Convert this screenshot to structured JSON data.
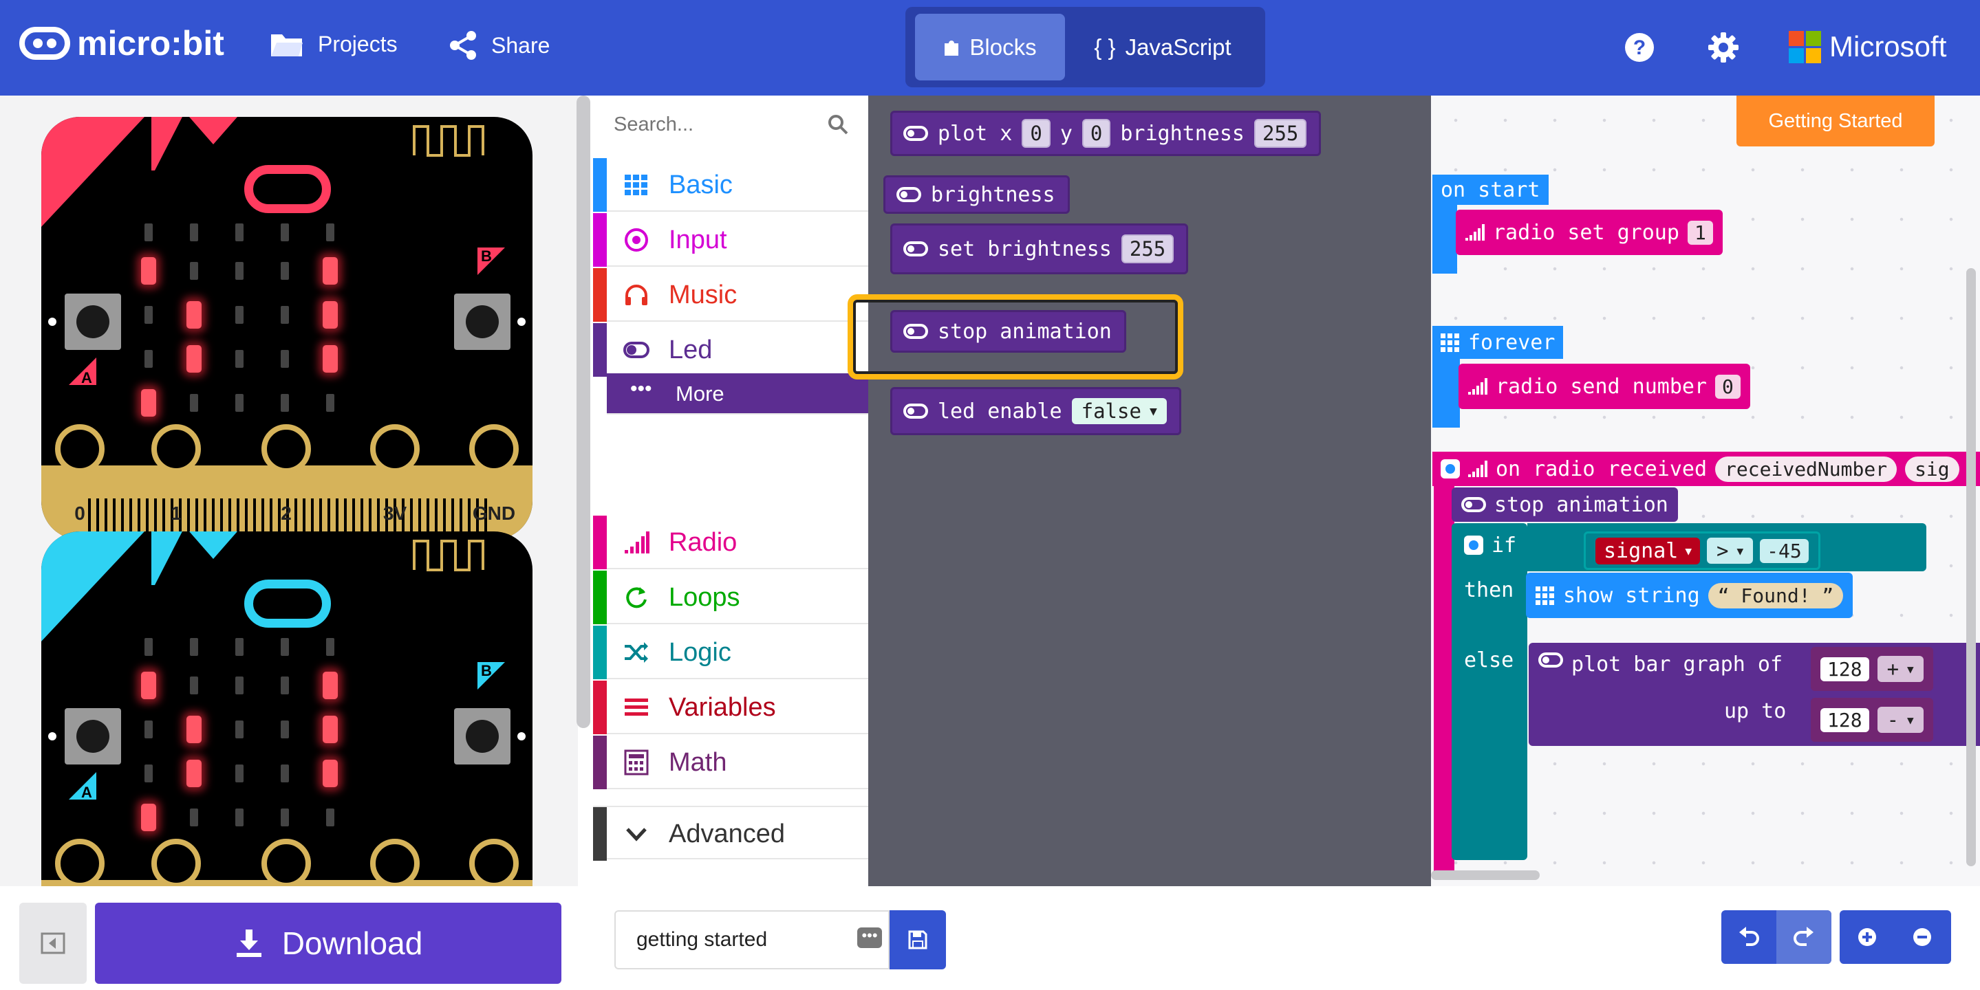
{
  "header": {
    "logo_text": "micro:bit",
    "projects_label": "Projects",
    "share_label": "Share",
    "tabs": [
      {
        "label": "Blocks",
        "active": true
      },
      {
        "label": "JavaScript",
        "active": false
      }
    ],
    "js_icon": "{ }",
    "brand": "Microsoft",
    "icons": [
      "help-icon",
      "gear-icon"
    ]
  },
  "simulator": {
    "pin_labels": [
      "0",
      "1",
      "2",
      "3V",
      "GND"
    ],
    "button_a": "A",
    "button_b": "B",
    "boards": [
      {
        "accent": "#ff3c5f"
      },
      {
        "accent": "#2fd2f3"
      }
    ]
  },
  "toolbox": {
    "search_placeholder": "Search...",
    "categories": [
      {
        "label": "Basic",
        "color": "#1e90ff"
      },
      {
        "label": "Input",
        "color": "#d400d4"
      },
      {
        "label": "Music",
        "color": "#e63022"
      },
      {
        "label": "Led",
        "color": "#5c2d91"
      },
      {
        "label": "More",
        "color": "#5c2d91"
      },
      {
        "label": "Radio",
        "color": "#e3008c"
      },
      {
        "label": "Loops",
        "color": "#00aa00"
      },
      {
        "label": "Logic",
        "color": "#00a4a6"
      },
      {
        "label": "Variables",
        "color": "#dc143c"
      },
      {
        "label": "Math",
        "color": "#9400d3"
      },
      {
        "label": "Advanced",
        "color": "#3c3c3c"
      }
    ]
  },
  "flyout": {
    "plot": {
      "label": "plot x",
      "x": "0",
      "y_label": "y",
      "y": "0",
      "b_label": "brightness",
      "b": "255"
    },
    "brightness": "brightness",
    "set_brightness": {
      "label": "set brightness",
      "value": "255"
    },
    "stop_animation": "stop animation",
    "led_enable": {
      "label": "led enable",
      "value": "false"
    }
  },
  "workspace": {
    "getting_started": "Getting Started",
    "on_start": "on start",
    "radio_set_group": {
      "label": "radio set group",
      "value": "1"
    },
    "forever": "forever",
    "radio_send_number": {
      "label": "radio send number",
      "value": "0"
    },
    "on_radio_received": {
      "label": "on radio received",
      "param1": "receivedNumber",
      "param2": "sig"
    },
    "stop_animation": "stop animation",
    "if_label": "if",
    "signal": "signal",
    "op": ">",
    "threshold": "-45",
    "then_label": "then",
    "show_string": {
      "label": "show string",
      "value": "Found!"
    },
    "else_label": "else",
    "plot_bar": {
      "label": "plot bar graph of",
      "v1": "128",
      "op1": "+",
      "upto": "up to",
      "v2": "128",
      "op2": "-"
    }
  },
  "footer": {
    "download_label": "Download",
    "project_name": "getting started"
  }
}
